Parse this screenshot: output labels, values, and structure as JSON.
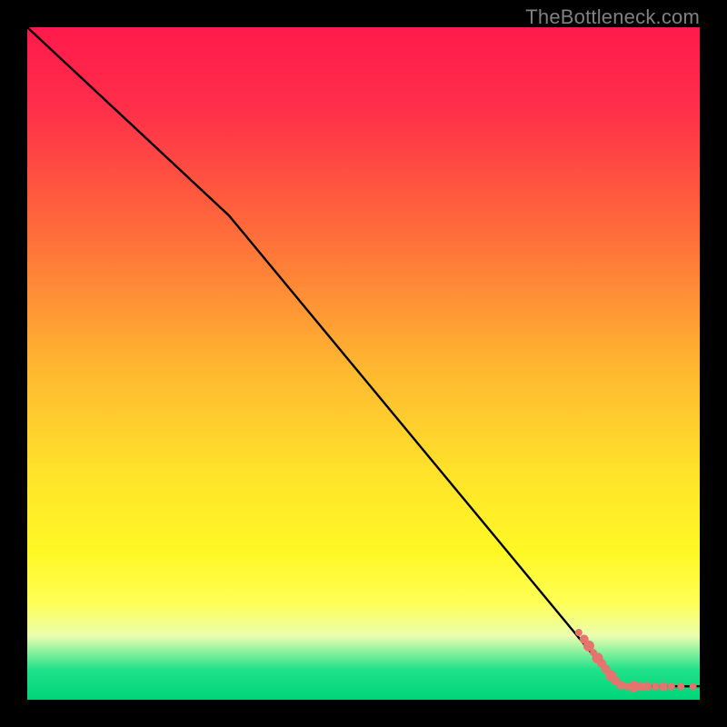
{
  "attribution": "TheBottleneck.com",
  "chart_data": {
    "type": "line",
    "title": "",
    "xlabel": "",
    "ylabel": "",
    "xlim": [
      0,
      100
    ],
    "ylim": [
      0,
      100
    ],
    "gradient_stops": [
      {
        "offset": 0.0,
        "color": "#ff1a4b"
      },
      {
        "offset": 0.12,
        "color": "#ff2f4a"
      },
      {
        "offset": 0.3,
        "color": "#ff6a3a"
      },
      {
        "offset": 0.5,
        "color": "#ffb531"
      },
      {
        "offset": 0.66,
        "color": "#ffe22a"
      },
      {
        "offset": 0.78,
        "color": "#fff825"
      },
      {
        "offset": 0.855,
        "color": "#ffff55"
      },
      {
        "offset": 0.905,
        "color": "#eaffb0"
      },
      {
        "offset": 0.955,
        "color": "#20e28a"
      },
      {
        "offset": 1.0,
        "color": "#00d479"
      }
    ],
    "series": [
      {
        "name": "bottleneck-curve",
        "x": [
          0,
          30,
          88,
          100
        ],
        "y": [
          100,
          72,
          2,
          2
        ]
      }
    ],
    "markers": {
      "name": "data-points",
      "color": "#e4746d",
      "points": [
        {
          "x": 82.0,
          "y": 10.0,
          "r": 4
        },
        {
          "x": 82.8,
          "y": 9.0,
          "r": 5
        },
        {
          "x": 83.5,
          "y": 8.0,
          "r": 6
        },
        {
          "x": 84.2,
          "y": 7.0,
          "r": 4
        },
        {
          "x": 84.8,
          "y": 6.2,
          "r": 6
        },
        {
          "x": 85.4,
          "y": 5.4,
          "r": 5
        },
        {
          "x": 86.0,
          "y": 4.6,
          "r": 5
        },
        {
          "x": 86.8,
          "y": 3.6,
          "r": 6
        },
        {
          "x": 87.5,
          "y": 2.8,
          "r": 5
        },
        {
          "x": 88.3,
          "y": 2.2,
          "r": 5
        },
        {
          "x": 89.2,
          "y": 2.0,
          "r": 4
        },
        {
          "x": 90.2,
          "y": 2.0,
          "r": 6
        },
        {
          "x": 91.2,
          "y": 2.0,
          "r": 5
        },
        {
          "x": 92.2,
          "y": 2.0,
          "r": 5
        },
        {
          "x": 93.4,
          "y": 2.0,
          "r": 4
        },
        {
          "x": 94.6,
          "y": 2.0,
          "r": 5
        },
        {
          "x": 95.8,
          "y": 2.0,
          "r": 4
        },
        {
          "x": 97.2,
          "y": 2.0,
          "r": 4
        },
        {
          "x": 99.0,
          "y": 2.0,
          "r": 4
        }
      ]
    }
  }
}
